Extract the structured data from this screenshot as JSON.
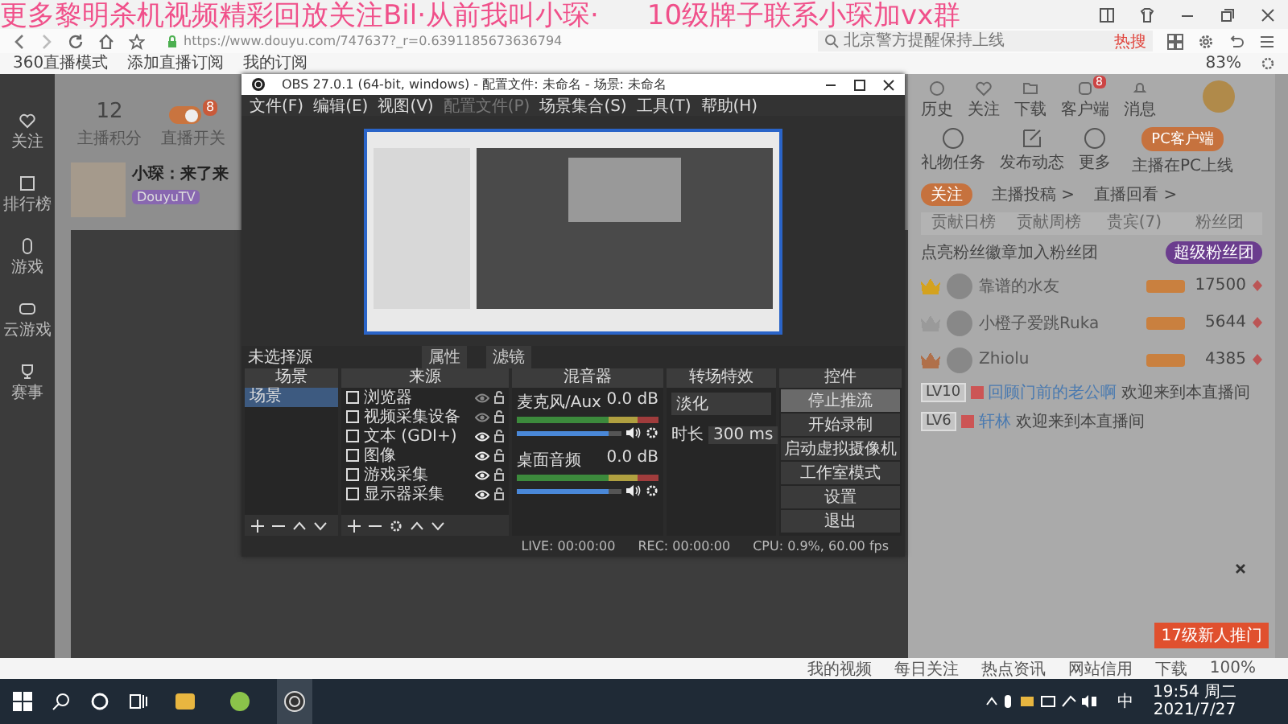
{
  "overlay_banner": {
    "left": "更多黎明杀机视频精彩回放关注Bil·从前我叫小琛·",
    "right": "10级牌子联系小琛加vx群"
  },
  "browser": {
    "url": "https://www.douyu.com/747637?_r=0.6391185673636794",
    "search_placeholder": "北京警方提醒保持上线",
    "search_hot": "热搜",
    "bookmarks": [
      "360直播模式",
      "添加直播订阅",
      "我的订阅"
    ],
    "battery": "83%"
  },
  "sidebar": {
    "items": [
      {
        "label": "关注"
      },
      {
        "label": "排行榜"
      },
      {
        "label": "游戏"
      },
      {
        "label": "云游戏"
      },
      {
        "label": "赛事"
      }
    ]
  },
  "streamer": {
    "score": "12",
    "score_label": "主播积分",
    "switch_label": "直播开关",
    "switch_on": true,
    "notify_count": "8",
    "title": "小琛：来了来",
    "platform": "DouyuTV"
  },
  "obs": {
    "title": "OBS 27.0.1 (64-bit, windows) - 配置文件: 未命名 - 场景: 未命名",
    "menu": [
      {
        "label": "文件(F)",
        "disabled": false
      },
      {
        "label": "编辑(E)",
        "disabled": false
      },
      {
        "label": "视图(V)",
        "disabled": false
      },
      {
        "label": "配置文件(P)",
        "disabled": true
      },
      {
        "label": "场景集合(S)",
        "disabled": false
      },
      {
        "label": "工具(T)",
        "disabled": false
      },
      {
        "label": "帮助(H)",
        "disabled": false
      }
    ],
    "source_status": "未选择源",
    "properties": "属性",
    "filters": "滤镜",
    "scenes": {
      "title": "场景",
      "items": [
        {
          "label": "场景",
          "selected": true
        }
      ]
    },
    "sources": {
      "title": "来源",
      "items": [
        {
          "label": "浏览器",
          "visible": false
        },
        {
          "label": "视频采集设备",
          "visible": false
        },
        {
          "label": "文本 (GDI+)",
          "visible": true
        },
        {
          "label": "图像",
          "visible": true
        },
        {
          "label": "游戏采集",
          "visible": true
        },
        {
          "label": "显示器采集",
          "visible": true
        }
      ]
    },
    "mixer": {
      "title": "混音器",
      "channels": [
        {
          "name": "麦克风/Aux",
          "reading": "0.0 dB",
          "level": 0.88
        },
        {
          "name": "桌面音频",
          "reading": "0.0 dB",
          "level": 0.88
        }
      ]
    },
    "transitions": {
      "title": "转场特效",
      "type": "淡化",
      "duration_label": "时长",
      "duration": "300 ms"
    },
    "controls": {
      "title": "控件",
      "buttons": [
        {
          "label": "停止推流",
          "highlighted": true
        },
        {
          "label": "开始录制",
          "highlighted": false
        },
        {
          "label": "启动虚拟摄像机",
          "highlighted": false
        },
        {
          "label": "工作室模式",
          "highlighted": false
        },
        {
          "label": "设置",
          "highlighted": false
        },
        {
          "label": "退出",
          "highlighted": false
        }
      ]
    },
    "status": {
      "live": "LIVE: 00:00:00",
      "rec": "REC: 00:00:00",
      "cpu": "CPU: 0.9%, 60.00 fps"
    }
  },
  "right_panel": {
    "follow": "关注",
    "top_icons": [
      {
        "label": "历史"
      },
      {
        "label": "关注"
      },
      {
        "label": "下载"
      },
      {
        "label": "客户端"
      },
      {
        "label": "消息"
      }
    ],
    "message_count": "8",
    "actions": [
      {
        "label": "礼物任务"
      },
      {
        "label": "发布动态"
      },
      {
        "label": "更多"
      }
    ],
    "pc_button": "PC客户端",
    "pc_caption": "主播在PC上线",
    "links": [
      "主播投稿 >",
      "直播回看 >"
    ],
    "tabs": [
      {
        "label": "贡献日榜",
        "selected": false
      },
      {
        "label": "贡献周榜",
        "selected": false
      },
      {
        "label": "贵宾(7)",
        "selected": false
      },
      {
        "label": "粉丝团",
        "selected": false
      }
    ],
    "notice": "点亮粉丝徽章加入粉丝团",
    "notice_button": "超级粉丝团",
    "ranks": [
      {
        "name": "靠谱的水友",
        "score": "17500",
        "color": "#d4a21e"
      },
      {
        "name": "小橙子爱跳Ruka",
        "score": "5644",
        "color": "#9a9a9a"
      },
      {
        "name": "Zhiolu",
        "score": "4385",
        "color": "#b0704a"
      }
    ],
    "chats": [
      {
        "level": "LV10",
        "user": "回顾门前的老公啊",
        "message": "欢迎来到本直播间"
      },
      {
        "level": "LV6",
        "user": "轩林",
        "message": "欢迎来到本直播间"
      }
    ],
    "gift_banner": "17级新人推门"
  },
  "status_bar": {
    "items": [
      "我的视频",
      "每日关注",
      "热点资讯",
      "网站信用",
      "下载"
    ],
    "zoom": "100%"
  },
  "taskbar": {
    "ime": "中",
    "time": "19:54 周二",
    "date": "2021/7/27"
  }
}
